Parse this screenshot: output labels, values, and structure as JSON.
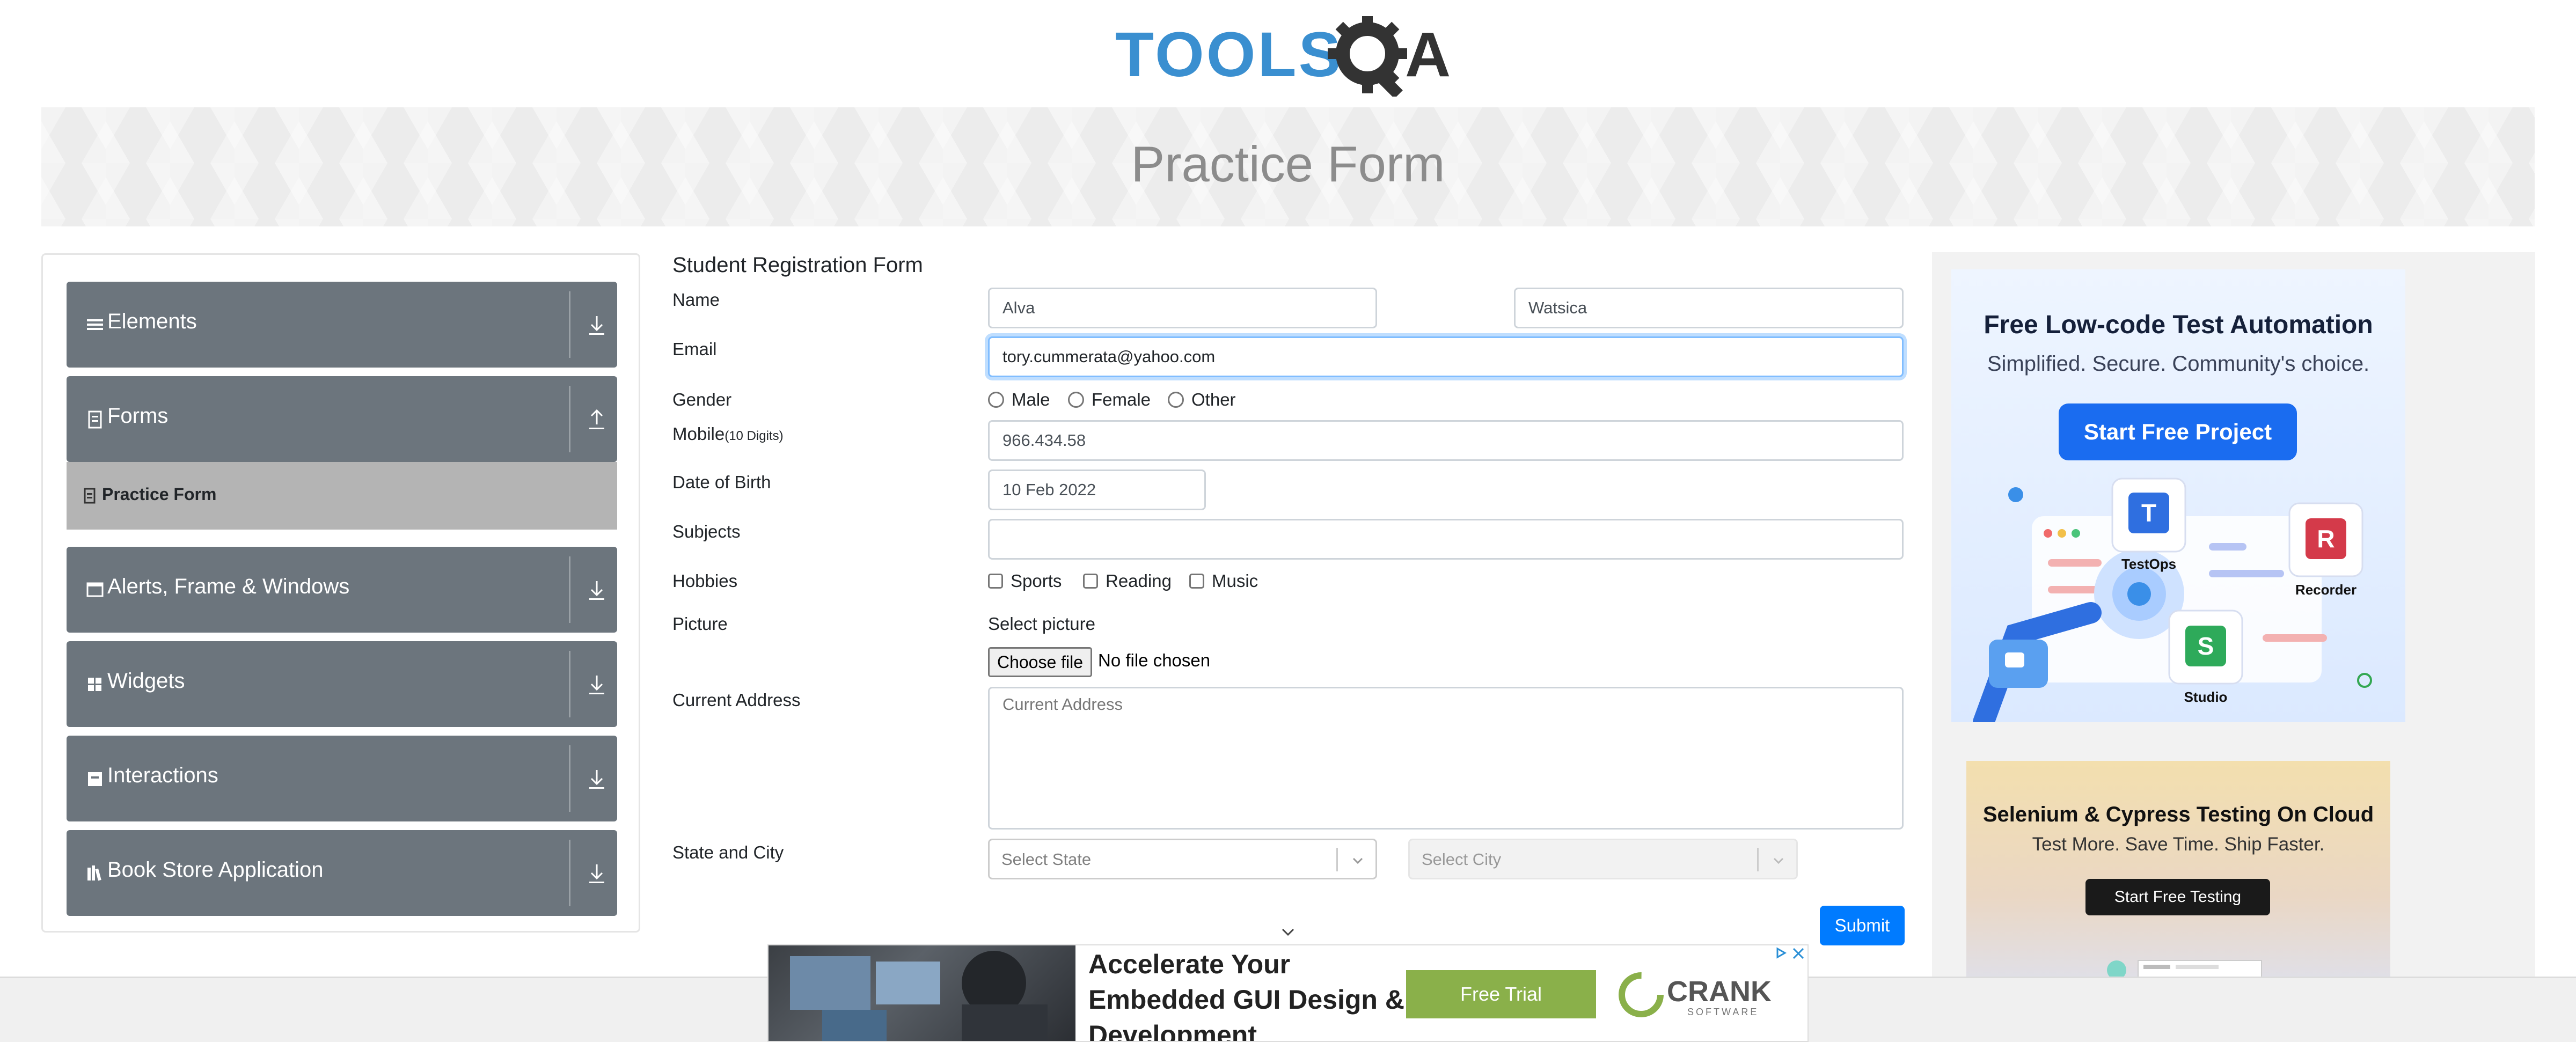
{
  "header": {
    "logo_text": "TOOLSQA",
    "page_title": "Practice Form"
  },
  "sidebar": {
    "groups": [
      {
        "label": "Elements",
        "icon": "list-icon",
        "arrow": "download-arrow-icon"
      },
      {
        "label": "Forms",
        "icon": "file-icon",
        "arrow": "upload-arrow-icon"
      },
      {
        "label": "Alerts, Frame & Windows",
        "icon": "window-icon",
        "arrow": "download-arrow-icon"
      },
      {
        "label": "Widgets",
        "icon": "grid-icon",
        "arrow": "download-arrow-icon"
      },
      {
        "label": "Interactions",
        "icon": "box-icon",
        "arrow": "download-arrow-icon"
      },
      {
        "label": "Book Store Application",
        "icon": "books-icon",
        "arrow": "download-arrow-icon"
      }
    ],
    "active_item": {
      "label": "Practice Form",
      "icon": "file-icon"
    }
  },
  "form": {
    "heading": "Student Registration Form",
    "labels": {
      "name": "Name",
      "email": "Email",
      "gender": "Gender",
      "mobile": "Mobile",
      "mobile_hint": "(10 Digits)",
      "dob": "Date of Birth",
      "subjects": "Subjects",
      "hobbies": "Hobbies",
      "picture": "Picture",
      "address": "Current Address",
      "state_city": "State and City"
    },
    "first_name": "Alva",
    "last_name": "Watsica",
    "email": "tory.cummerata@yahoo.com",
    "gender_options": [
      "Male",
      "Female",
      "Other"
    ],
    "mobile": "966.434.58",
    "dob": "10 Feb 2022",
    "subjects": "",
    "hobbies": [
      "Sports",
      "Reading",
      "Music"
    ],
    "picture_label": "Select picture",
    "choose_file": "Choose file",
    "no_file": "No file chosen",
    "address_placeholder": "Current Address",
    "state_placeholder": "Select State",
    "city_placeholder": "Select City",
    "submit": "Submit"
  },
  "ads": {
    "katalon": {
      "title": "Free Low-code Test Automation",
      "subtitle": "Simplified. Secure. Community's choice.",
      "button": "Start Free Project",
      "products": [
        "TestOps",
        "Recorder",
        "Studio"
      ]
    },
    "cloud": {
      "title": "Selenium & Cypress Testing On Cloud",
      "subtitle": "Test More. Save Time. Ship Faster.",
      "button": "Start Free Testing"
    },
    "bottom": {
      "headline": "Accelerate Your Embedded GUI Design & Development",
      "button": "Free Trial",
      "brand": "CRANK",
      "brand_sub": "SOFTWARE"
    }
  },
  "colors": {
    "primary": "#007bff",
    "sidebar": "#6c757d",
    "logo_blue": "#3a8fd0",
    "logo_dark": "#333333"
  }
}
